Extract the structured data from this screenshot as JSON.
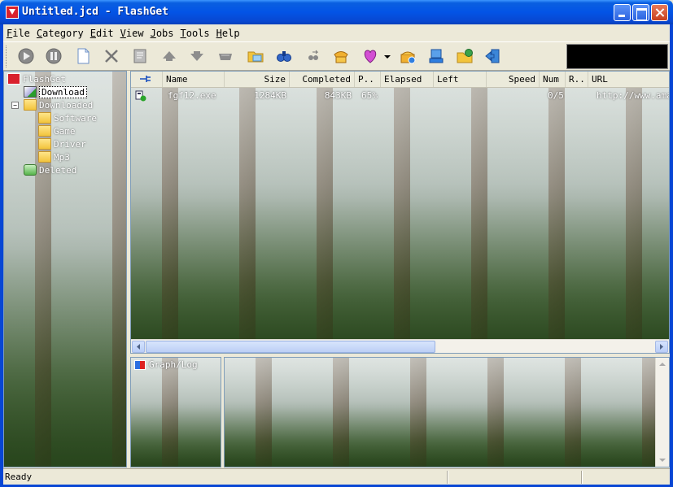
{
  "window": {
    "title": "Untitled.jcd - FlashGet"
  },
  "menu": [
    {
      "label": "File",
      "key": "F"
    },
    {
      "label": "Category",
      "key": "C"
    },
    {
      "label": "Edit",
      "key": "E"
    },
    {
      "label": "View",
      "key": "V"
    },
    {
      "label": "Jobs",
      "key": "J"
    },
    {
      "label": "Tools",
      "key": "T"
    },
    {
      "label": "Help",
      "key": "H"
    }
  ],
  "toolbar": {
    "icons": [
      "start-icon",
      "pause-icon",
      "new-icon",
      "delete-icon",
      "properties-icon",
      "move-up-icon",
      "move-down-icon",
      "import-icon",
      "open-folder-icon",
      "find-icon",
      "find-next-icon",
      "dial-icon",
      "scheme-icon",
      "scheme-dropdown-icon",
      "dialer-icon",
      "site-manager-icon",
      "default-download-folder-icon",
      "exit-icon"
    ]
  },
  "tree": {
    "root": "FlashGet",
    "items": [
      {
        "label": "Download",
        "selected": true
      },
      {
        "label": "Downloaded",
        "expanded": true
      },
      {
        "label": "Software"
      },
      {
        "label": "Game"
      },
      {
        "label": "Driver"
      },
      {
        "label": "Mp3"
      },
      {
        "label": "Deleted"
      }
    ]
  },
  "list": {
    "columns": [
      "Name",
      "Size",
      "Completed",
      "P..",
      "Elapsed",
      "Left",
      "Speed",
      "Num",
      "R..",
      "URL"
    ],
    "rows": [
      {
        "name": "fgf12.exe",
        "size": "1284KB",
        "completed": "843KB",
        "percent": "65%",
        "elapsed": "",
        "left": "",
        "speed": "",
        "num": "0/5",
        "r": "",
        "url": "http://www.amaz"
      }
    ]
  },
  "graph": {
    "label": "Graph/Log"
  },
  "status": {
    "text": "Ready"
  }
}
